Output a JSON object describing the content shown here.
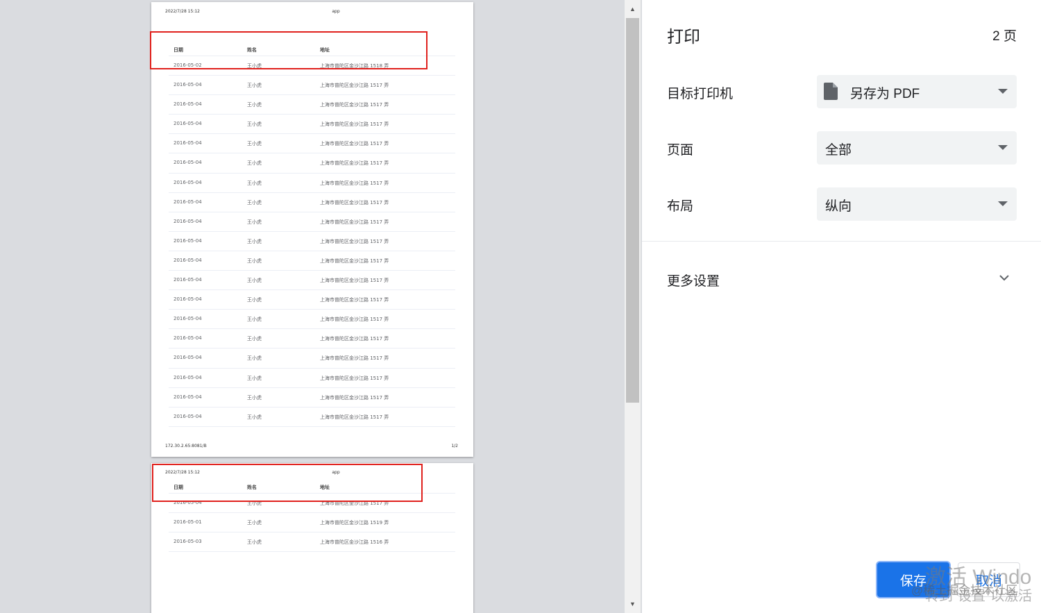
{
  "preview": {
    "header_date": "2022/7/28 15:12",
    "header_title": "app",
    "footer_url": "172.30.2.65:8081/B",
    "footer_page": "1/2",
    "columns": [
      "日期",
      "姓名",
      "地址"
    ],
    "page1_rows": [
      [
        "2016-05-02",
        "王小虎",
        "上海市普陀区金沙江路 1518 弄"
      ],
      [
        "2016-05-04",
        "王小虎",
        "上海市普陀区金沙江路 1517 弄"
      ],
      [
        "2016-05-04",
        "王小虎",
        "上海市普陀区金沙江路 1517 弄"
      ],
      [
        "2016-05-04",
        "王小虎",
        "上海市普陀区金沙江路 1517 弄"
      ],
      [
        "2016-05-04",
        "王小虎",
        "上海市普陀区金沙江路 1517 弄"
      ],
      [
        "2016-05-04",
        "王小虎",
        "上海市普陀区金沙江路 1517 弄"
      ],
      [
        "2016-05-04",
        "王小虎",
        "上海市普陀区金沙江路 1517 弄"
      ],
      [
        "2016-05-04",
        "王小虎",
        "上海市普陀区金沙江路 1517 弄"
      ],
      [
        "2016-05-04",
        "王小虎",
        "上海市普陀区金沙江路 1517 弄"
      ],
      [
        "2016-05-04",
        "王小虎",
        "上海市普陀区金沙江路 1517 弄"
      ],
      [
        "2016-05-04",
        "王小虎",
        "上海市普陀区金沙江路 1517 弄"
      ],
      [
        "2016-05-04",
        "王小虎",
        "上海市普陀区金沙江路 1517 弄"
      ],
      [
        "2016-05-04",
        "王小虎",
        "上海市普陀区金沙江路 1517 弄"
      ],
      [
        "2016-05-04",
        "王小虎",
        "上海市普陀区金沙江路 1517 弄"
      ],
      [
        "2016-05-04",
        "王小虎",
        "上海市普陀区金沙江路 1517 弄"
      ],
      [
        "2016-05-04",
        "王小虎",
        "上海市普陀区金沙江路 1517 弄"
      ],
      [
        "2016-05-04",
        "王小虎",
        "上海市普陀区金沙江路 1517 弄"
      ],
      [
        "2016-05-04",
        "王小虎",
        "上海市普陀区金沙江路 1517 弄"
      ],
      [
        "2016-05-04",
        "王小虎",
        "上海市普陀区金沙江路 1517 弄"
      ]
    ],
    "page2_rows": [
      [
        "2016-05-04",
        "王小虎",
        "上海市普陀区金沙江路 1517 弄"
      ],
      [
        "2016-05-01",
        "王小虎",
        "上海市普陀区金沙江路 1519 弄"
      ],
      [
        "2016-05-03",
        "王小虎",
        "上海市普陀区金沙江路 1516 弄"
      ]
    ]
  },
  "panel": {
    "title": "打印",
    "page_count": "2 页",
    "destination_label": "目标打印机",
    "destination_value": "另存为 PDF",
    "pages_label": "页面",
    "pages_value": "全部",
    "layout_label": "布局",
    "layout_value": "纵向",
    "more_settings": "更多设置",
    "save_button": "保存",
    "cancel_button": "取消"
  },
  "watermark": {
    "line1": "激活 Windo",
    "line2": "转到\"设置\"以激活",
    "line3": "@稀土掘金技术社区"
  },
  "colors": {
    "accent": "#1a73e8",
    "highlight_box": "#e0201c",
    "select_bg": "#f1f3f4"
  }
}
